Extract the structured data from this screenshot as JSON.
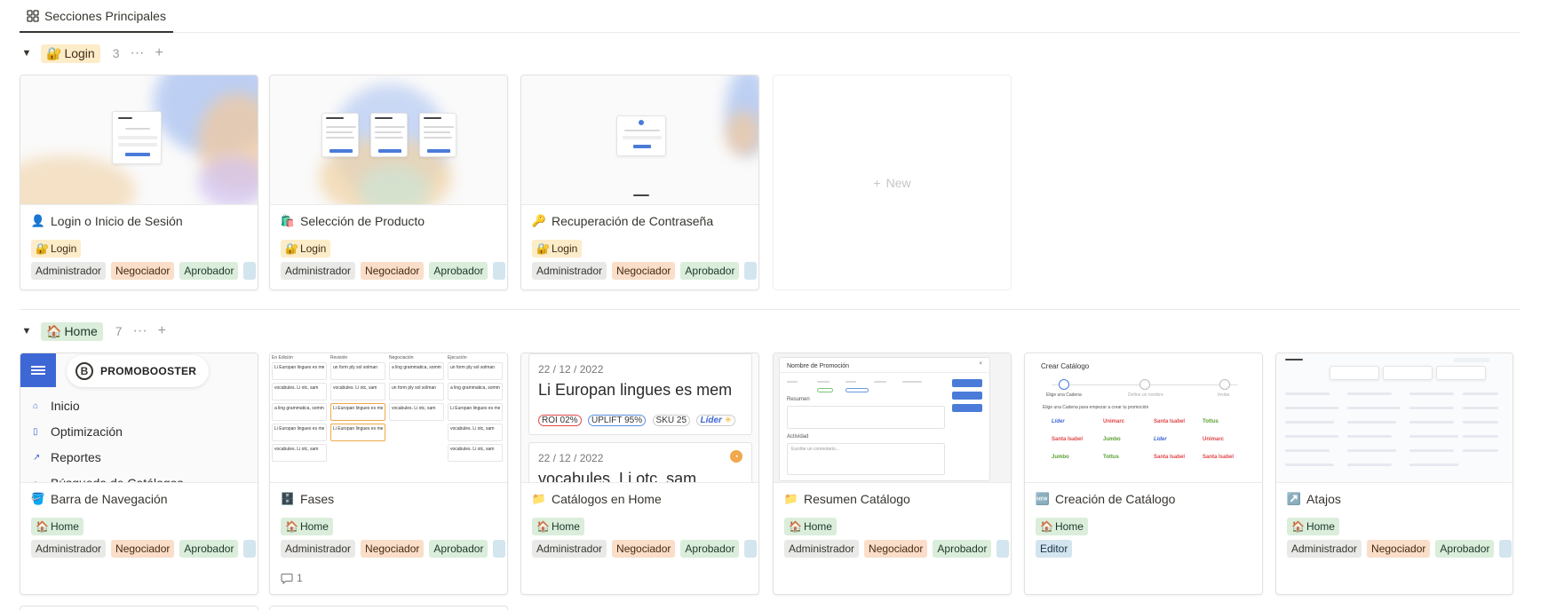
{
  "view": {
    "tab_label": "Secciones Principales",
    "icon": "gallery-grid-icon"
  },
  "roles": {
    "admin": "Administrador",
    "neg": "Negociador",
    "apr": "Aprobador",
    "edi": "Editor"
  },
  "groups": [
    {
      "label": "Login",
      "emoji": "🔐",
      "count": "3",
      "new_label": "New",
      "cards": [
        {
          "title": "Login o Inicio de Sesión",
          "emoji": "👤",
          "section": "Login",
          "section_emoji": "🔐"
        },
        {
          "title": "Selección de Producto",
          "emoji": "🛍️",
          "section": "Login",
          "section_emoji": "🔐"
        },
        {
          "title": "Recuperación de Contraseña",
          "emoji": "🔑",
          "section": "Login",
          "section_emoji": "🔐"
        }
      ]
    },
    {
      "label": "Home",
      "emoji": "🏠",
      "count": "7",
      "cards": [
        {
          "title": "Barra de Navegación",
          "emoji": "🪣",
          "section": "Home",
          "section_emoji": "🏠"
        },
        {
          "title": "Fases",
          "emoji": "🗄️",
          "section": "Home",
          "section_emoji": "🏠",
          "comments": "1"
        },
        {
          "title": "Catálogos en Home",
          "emoji": "📁",
          "section": "Home",
          "section_emoji": "🏠"
        },
        {
          "title": "Resumen Catálogo",
          "emoji": "📁",
          "section": "Home",
          "section_emoji": "🏠"
        },
        {
          "title": "Creación de Catálogo",
          "emoji": "🆕",
          "section": "Home",
          "section_emoji": "🏠"
        },
        {
          "title": "Atajos",
          "emoji": "↗️",
          "section": "Home",
          "section_emoji": "🏠"
        }
      ]
    }
  ],
  "covers": {
    "nav": {
      "brand": "PROMOBOOSTER",
      "items": [
        "Inicio",
        "Optimización",
        "Reportes",
        "Búsqueda de Catálogos"
      ]
    },
    "phases": {
      "columns": [
        "En Edición",
        "Revisión",
        "Negociación",
        "Ejecución"
      ],
      "card_text": [
        "Li Europan lingues es mem",
        "vocabules. Li otc, sam",
        "a ling grammatica, somman",
        "Li Europan lingues es mem",
        "vocabules. Li otc, sam",
        "un form ply sol solman",
        "vocabules. Li otc, sam",
        "Li Europan lingues es mem",
        "Li Europan lingues es mem",
        "vocabules. Li otc, sam",
        "Li Europan lingues es mem",
        "a ling grammatica, somman"
      ]
    },
    "catalog": {
      "date_1": "22 / 12 / 2022",
      "headline_1": "Li Europan lingues es mem",
      "metrics": [
        "ROI 02%",
        "UPLIFT 95%",
        "SKU 25"
      ],
      "retailer": "Líder",
      "date_2": "22 / 12 / 2022",
      "headline_2": "vocabules. Li otc, sam"
    },
    "summary": {
      "title": "Nombre de Promoción",
      "section_1": "Resumen",
      "section_2": "Actividad",
      "placeholder": "Escribe un comentario..."
    },
    "create": {
      "title": "Crear Catálogo",
      "steps": [
        "Elige una Cadena",
        "Define un nombre",
        "Invitar"
      ],
      "subtitle": "Elige una Cadena para empezar a crear tu promoción",
      "brands": [
        "Líder",
        "Unimarc",
        "Santa Isabel",
        "Tottus",
        "Santa Isabel",
        "Jumbo",
        "Líder",
        "Unimarc",
        "Jumbo",
        "Tottus",
        "Santa Isabel",
        "Santa Isabel"
      ]
    }
  },
  "colors": {
    "login_tag_bg": "#fdecc8",
    "home_tag_bg": "#dbeddb",
    "brand_blue": "#3e67d6"
  }
}
